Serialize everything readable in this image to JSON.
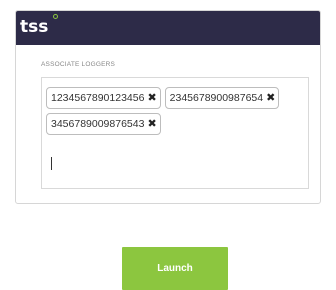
{
  "app": {
    "logo_text": "tss",
    "header_color": "#2d2b48",
    "accent_color": "#8cc63f"
  },
  "form": {
    "section_label": "ASSOCIATE LOGGERS",
    "tags": [
      {
        "value": "1234567890123456",
        "remove_icon": "close-icon"
      },
      {
        "value": "2345678900987654",
        "remove_icon": "close-icon"
      },
      {
        "value": "3456789009876543",
        "remove_icon": "close-icon"
      }
    ],
    "input_value": "",
    "input_placeholder": ""
  },
  "actions": {
    "launch_label": "Launch"
  }
}
